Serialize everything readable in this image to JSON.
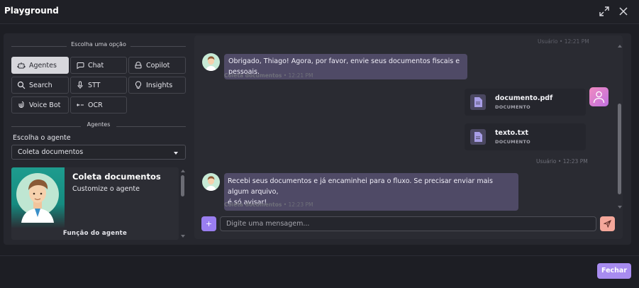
{
  "window": {
    "title": "Playground"
  },
  "options": {
    "heading": "Escolha uma opção",
    "items": [
      {
        "label": "Agentes",
        "icon": "robot-icon",
        "active": true
      },
      {
        "label": "Chat",
        "icon": "chat-bubble-icon"
      },
      {
        "label": "Copilot",
        "icon": "copilot-icon"
      },
      {
        "label": "Search",
        "icon": "search-icon"
      },
      {
        "label": "STT",
        "icon": "microphone-icon"
      },
      {
        "label": "Insights",
        "icon": "lightbulb-icon"
      },
      {
        "label": "Voice Bot",
        "icon": "voice-icon"
      },
      {
        "label": "OCR",
        "icon": "ocr-icon"
      }
    ]
  },
  "agents": {
    "heading": "Agentes",
    "select_label": "Escolha o agente",
    "selected": "Coleta documentos",
    "card": {
      "name": "Coleta documentos",
      "subtitle": "Customize o agente",
      "role_label": "Função do agente"
    }
  },
  "chat": {
    "truncated_meta": "Usuário • 12:21 PM",
    "messages": [
      {
        "text": "Obrigado, Thiago! Agora, por favor, envie seus documentos fiscais e pessoais.",
        "sender": "Coleta documentos",
        "time": "12:21 PM"
      },
      {
        "text_line1": "Recebi seus documentos e já encaminhei para o fluxo. Se precisar enviar mais algum arquivo,",
        "text_line2": "é só avisar!",
        "sender": "Coleta documentos",
        "time": "12:23 PM"
      }
    ],
    "files": [
      {
        "name": "documento.pdf",
        "type": "DOCUMENTO"
      },
      {
        "name": "texto.txt",
        "type": "DOCUMENTO"
      }
    ],
    "user_meta": {
      "sender": "Usuário",
      "time": "12:23 PM"
    },
    "input_placeholder": "Digite uma mensagem...",
    "plus_label": "+"
  },
  "footer": {
    "close_label": "Fechar"
  },
  "colors": {
    "accent": "#a88cf0",
    "bubble": "#4f4a66",
    "send": "#f4a79a"
  }
}
